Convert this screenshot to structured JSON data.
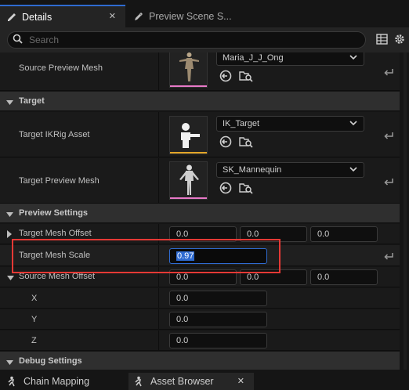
{
  "tabs": [
    {
      "label": "Details",
      "close": "✕"
    },
    {
      "label": "Preview Scene S..."
    }
  ],
  "search": {
    "placeholder": "Search"
  },
  "rows": {
    "source_preview_mesh": {
      "label": "Source Preview Mesh",
      "value": "Maria_J_J_Ong"
    },
    "target_category": {
      "label": "Target"
    },
    "target_ikrig": {
      "label": "Target IKRig Asset",
      "value": "IK_Target"
    },
    "target_preview_mesh": {
      "label": "Target Preview Mesh",
      "value": "SK_Mannequin"
    },
    "preview_category": {
      "label": "Preview Settings"
    },
    "target_mesh_offset": {
      "label": "Target Mesh Offset",
      "values": [
        "0.0",
        "0.0",
        "0.0"
      ]
    },
    "target_mesh_scale": {
      "label": "Target Mesh Scale",
      "value": "0.97"
    },
    "source_mesh_offset": {
      "label": "Source Mesh Offset",
      "values": [
        "0.0",
        "0.0",
        "0.0"
      ]
    },
    "x": {
      "label": "X",
      "value": "0.0"
    },
    "y": {
      "label": "Y",
      "value": "0.0"
    },
    "z": {
      "label": "Z",
      "value": "0.0"
    },
    "debug_category": {
      "label": "Debug Settings"
    }
  },
  "bottom_tabs": [
    {
      "label": "Chain Mapping"
    },
    {
      "label": "Asset Browser",
      "close": "✕"
    }
  ],
  "colors": {
    "accent": "#2f6bd1",
    "skeletal_mesh_bar": "#e879c8",
    "ikrig_bar": "#e2a527",
    "highlight_box": "#e53935"
  }
}
